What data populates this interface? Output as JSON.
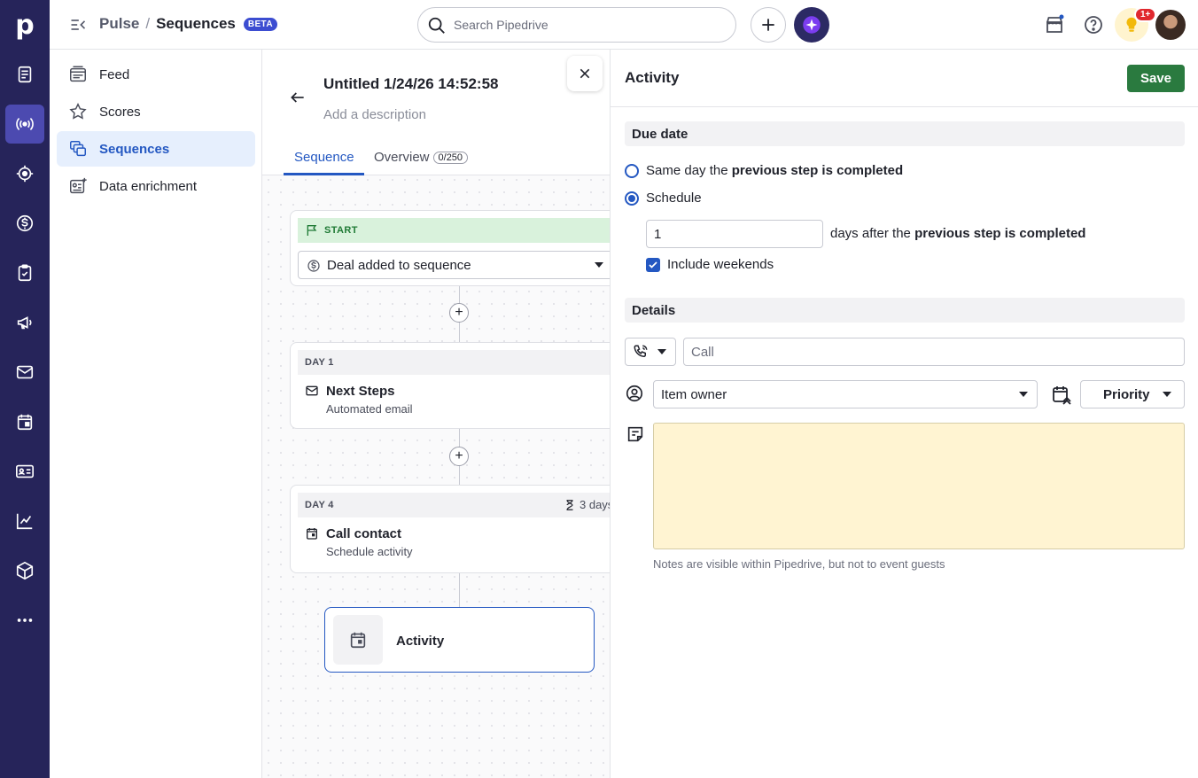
{
  "rail": {
    "logo": "p",
    "items": [
      "leads",
      "pulse",
      "deals",
      "money",
      "tasks",
      "campaigns",
      "mail",
      "calendar",
      "contacts",
      "insights",
      "products",
      "more"
    ]
  },
  "topbar": {
    "crumb_app": "Pulse",
    "crumb_sep": "/",
    "crumb_page": "Sequences",
    "beta": "BETA",
    "search_placeholder": "Search Pipedrive",
    "notif_count": "1+"
  },
  "subnav": {
    "items": [
      {
        "label": "Feed",
        "icon": "feed-icon"
      },
      {
        "label": "Scores",
        "icon": "scores-icon"
      },
      {
        "label": "Sequences",
        "icon": "sequences-icon",
        "active": true
      },
      {
        "label": "Data enrichment",
        "icon": "data-enrichment-icon"
      }
    ]
  },
  "sequence": {
    "title": "Untitled 1/24/26 14:52:58",
    "description_placeholder": "Add a description",
    "tabs": [
      {
        "label": "Sequence",
        "active": true
      },
      {
        "label": "Overview",
        "count": "0/250"
      }
    ],
    "start": {
      "band": "START",
      "trigger": "Deal added to sequence"
    },
    "steps": [
      {
        "day": "DAY 1",
        "title": "Next Steps",
        "subtitle": "Automated email"
      },
      {
        "day": "DAY 4",
        "wait": "3 days",
        "title": "Call contact",
        "subtitle": "Schedule activity"
      }
    ],
    "new_step": "Activity"
  },
  "panel": {
    "title": "Activity",
    "save_label": "Save",
    "due_section": "Due date",
    "option_same_day_prefix": "Same day the",
    "option_same_day_bold": "previous step is completed",
    "option_schedule": "Schedule",
    "days_value": "1",
    "days_text_prefix": "days after the",
    "days_text_bold": "previous step is completed",
    "include_weekends": "Include weekends",
    "details_section": "Details",
    "subject_placeholder": "Call",
    "owner": "Item owner",
    "priority": "Priority",
    "notes_hint": "Notes are visible within Pipedrive, but not to event guests"
  },
  "colors": {
    "rail": "#26245a",
    "accent": "#2458c2",
    "save": "#2a7a3f",
    "notes": "#fff4d2"
  }
}
